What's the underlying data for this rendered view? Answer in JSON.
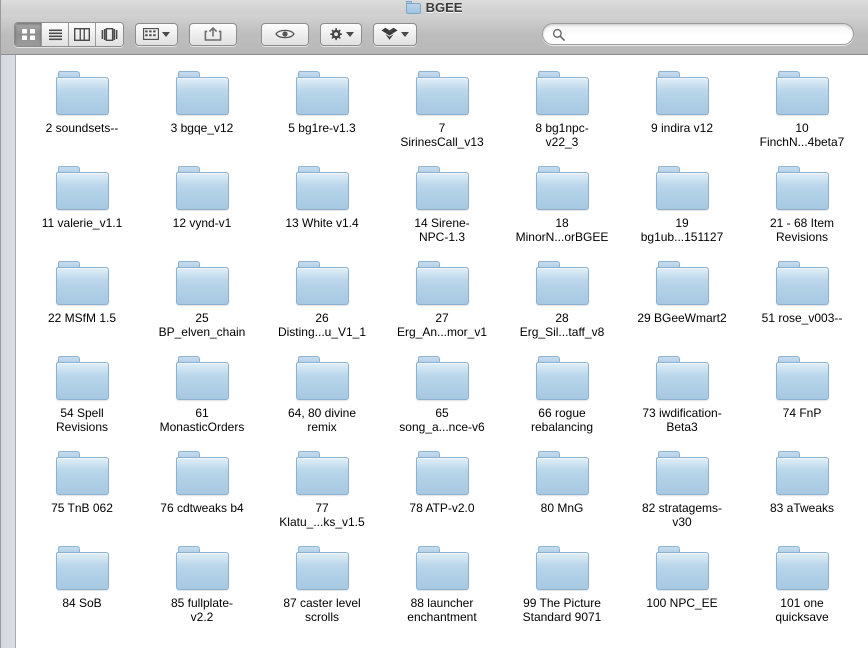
{
  "window": {
    "title": "BGEE",
    "proxy_icon": "folder-icon"
  },
  "toolbar": {
    "view_buttons": [
      {
        "name": "icon-view-button",
        "icon": "grid-icon",
        "active": true
      },
      {
        "name": "list-view-button",
        "icon": "list-icon",
        "active": false
      },
      {
        "name": "column-view-button",
        "icon": "columns-icon",
        "active": false
      },
      {
        "name": "coverflow-view-button",
        "icon": "coverflow-icon",
        "active": false
      }
    ],
    "arrange_button": {
      "name": "arrange-by-button",
      "icon": "arrange-grid-icon"
    },
    "share_button": {
      "name": "share-button",
      "icon": "share-arrow-icon"
    },
    "quicklook_button": {
      "name": "quick-look-button",
      "icon": "eye-icon"
    },
    "action_button": {
      "name": "action-menu-button",
      "icon": "gear-icon"
    },
    "dropbox_button": {
      "name": "dropbox-button",
      "icon": "dropbox-icon"
    }
  },
  "search": {
    "value": "",
    "placeholder": "",
    "icon": "search-icon"
  },
  "files": [
    {
      "label": "2 soundsets--"
    },
    {
      "label": "3 bgqe_v12"
    },
    {
      "label": "5 bg1re-v1.3"
    },
    {
      "label": "7\nSirinesCall_v13"
    },
    {
      "label": "8 bg1npc-\nv22_3"
    },
    {
      "label": "9 indira v12"
    },
    {
      "label": "10\nFinchN...4beta7"
    },
    {
      "label": "11 valerie_v1.1"
    },
    {
      "label": "12 vynd-v1"
    },
    {
      "label": "13 White v1.4"
    },
    {
      "label": "14 Sirene-\nNPC-1.3"
    },
    {
      "label": "18\nMinorN...orBGEE"
    },
    {
      "label": "19\nbg1ub...151127"
    },
    {
      "label": "21 - 68 Item\nRevisions"
    },
    {
      "label": "22 MSfM 1.5"
    },
    {
      "label": "25\nBP_elven_chain"
    },
    {
      "label": "26\nDisting...u_V1_1"
    },
    {
      "label": "27\nErg_An...mor_v1"
    },
    {
      "label": "28\nErg_Sil...taff_v8"
    },
    {
      "label": "29 BGeeWmart2"
    },
    {
      "label": "51 rose_v003--"
    },
    {
      "label": "54 Spell\nRevisions"
    },
    {
      "label": "61\nMonasticOrders"
    },
    {
      "label": "64, 80 divine\nremix"
    },
    {
      "label": "65\nsong_a...nce-v6"
    },
    {
      "label": "66 rogue\nrebalancing"
    },
    {
      "label": "73 iwdification-\nBeta3"
    },
    {
      "label": "74 FnP"
    },
    {
      "label": "75 TnB 062"
    },
    {
      "label": "76 cdtweaks b4"
    },
    {
      "label": "77\nKlatu_...ks_v1.5"
    },
    {
      "label": "78 ATP-v2.0"
    },
    {
      "label": "80 MnG"
    },
    {
      "label": "82 stratagems-\nv30"
    },
    {
      "label": "83 aTweaks"
    },
    {
      "label": "84 SoB"
    },
    {
      "label": "85 fullplate-\nv2.2"
    },
    {
      "label": "87 caster level\nscrolls"
    },
    {
      "label": "88 launcher\nenchantment"
    },
    {
      "label": "99 The Picture\nStandard 9071"
    },
    {
      "label": "100 NPC_EE"
    },
    {
      "label": "101 one\nquicksave"
    }
  ],
  "colors": {
    "folder_fill": "#b6d4e9",
    "folder_stroke": "#8db2d0",
    "toolbar_top": "#d3d3d3",
    "toolbar_bottom": "#b8b8b8",
    "sidebar": "#d8dce2",
    "content_bg": "#ffffff"
  }
}
